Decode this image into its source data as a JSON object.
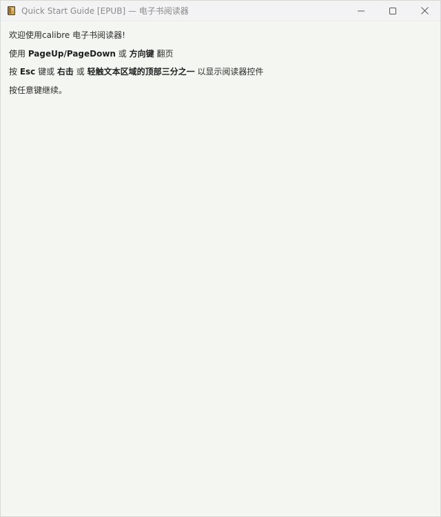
{
  "window": {
    "title": "Quick Start Guide [EPUB] — 电子书阅读器",
    "app_icon": "calibre-book-icon",
    "controls": [
      "minimize-icon",
      "maximize-icon",
      "close-icon"
    ]
  },
  "content": {
    "line1": "欢迎使用calibre 电子书阅读器!",
    "line2": {
      "t1": "使用 ",
      "b1": "PageUp/PageDown",
      "t2": " 或 ",
      "b2": "方向键",
      "t3": " 翻页"
    },
    "line3": {
      "t1": "按 ",
      "b1": "Esc",
      "t2": " 键或 ",
      "b2": "右击",
      "t3": " 或 ",
      "b3": "轻触文本区域的顶部三分之一",
      "t4": " 以显示阅读器控件"
    },
    "line4": "按任意键继续。"
  }
}
